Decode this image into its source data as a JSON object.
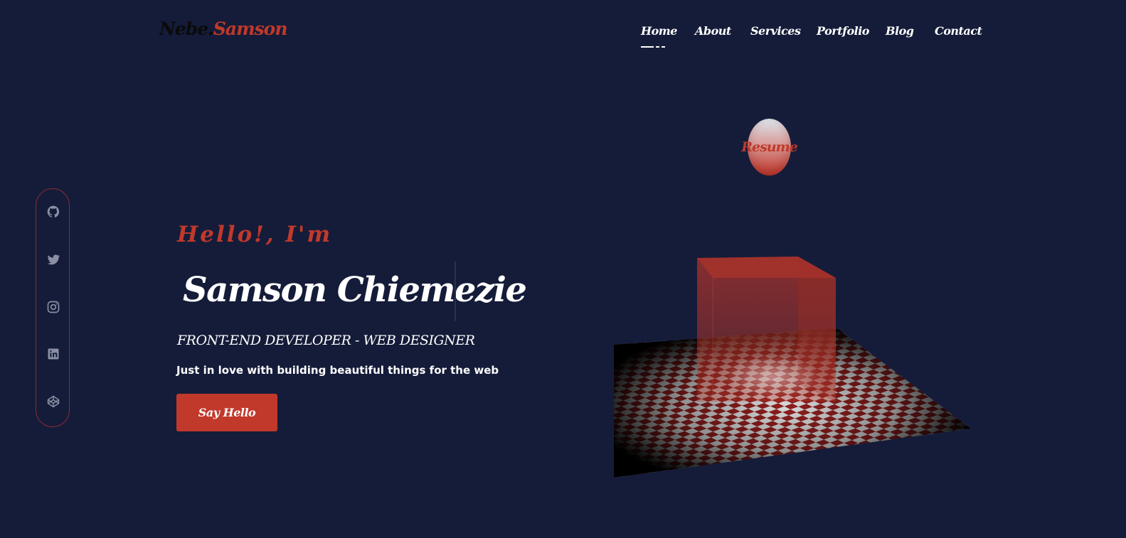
{
  "header": {
    "logo_first": "Nebe.",
    "logo_last": "Samson",
    "nav": [
      "Home",
      "About",
      "Services",
      "Portfolio",
      "Blog",
      "Contact"
    ],
    "active_nav": "Home"
  },
  "social": [
    "github-icon",
    "twitter-icon",
    "instagram-icon",
    "linkedin-icon",
    "codepen-icon"
  ],
  "resume_label": "Resume",
  "hero": {
    "greeting": "Hello!, I'm",
    "name": "Samson Chiemezie",
    "role": "FRONT-END DEVELOPER - WEB DESIGNER",
    "tagline": "Just in love with building beautiful things for the web",
    "cta_label": "Say Hello"
  },
  "colors": {
    "background": "#151c39",
    "accent": "#c0392b",
    "text": "#ffffff"
  }
}
